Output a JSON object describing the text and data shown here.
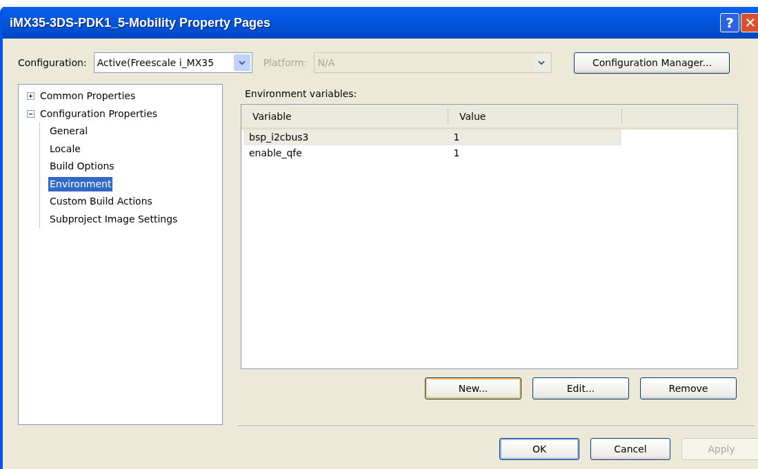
{
  "window": {
    "title": "iMX35-3DS-PDK1_5-Mobility Property Pages",
    "buttons": [
      {
        "kind": "help",
        "label": "?"
      },
      {
        "kind": "close",
        "label": "✕"
      }
    ]
  },
  "toolbar": {
    "configuration": {
      "label": "Configuration:",
      "value": "Active(Freescale i_MX35",
      "disabled": false
    },
    "platform": {
      "label": "Platform:",
      "value": "N/A",
      "disabled": true
    },
    "manager_button": {
      "label": "Configuration Manager..."
    }
  },
  "tree": [
    {
      "label": "Common Properties",
      "expanded": false,
      "selected": false
    },
    {
      "label": "Configuration Properties",
      "expanded": true,
      "selected": false,
      "children": [
        {
          "label": "General",
          "selected": false
        },
        {
          "label": "Locale",
          "selected": false
        },
        {
          "label": "Build Options",
          "selected": false
        },
        {
          "label": "Environment",
          "selected": true
        },
        {
          "label": "Custom Build Actions",
          "selected": false
        },
        {
          "label": "Subproject Image Settings",
          "selected": false
        }
      ]
    }
  ],
  "environment": {
    "label": "Environment variables:",
    "columns": [
      "Variable",
      "Value"
    ],
    "rows": [
      {
        "cells": [
          "bsp_i2cbus3",
          "1"
        ],
        "selected": true
      },
      {
        "cells": [
          "enable_qfe",
          "1"
        ],
        "selected": false
      }
    ],
    "buttons": [
      {
        "label": "New...",
        "focused": true,
        "disabled": false
      },
      {
        "label": "Edit...",
        "focused": false,
        "disabled": false
      },
      {
        "label": "Remove",
        "focused": false,
        "disabled": false
      }
    ]
  },
  "footer_buttons": [
    {
      "label": "OK",
      "focused": false,
      "disabled": false,
      "default": true
    },
    {
      "label": "Cancel",
      "focused": false,
      "disabled": false,
      "default": false
    },
    {
      "label": "Apply",
      "focused": false,
      "disabled": true,
      "default": false
    }
  ]
}
